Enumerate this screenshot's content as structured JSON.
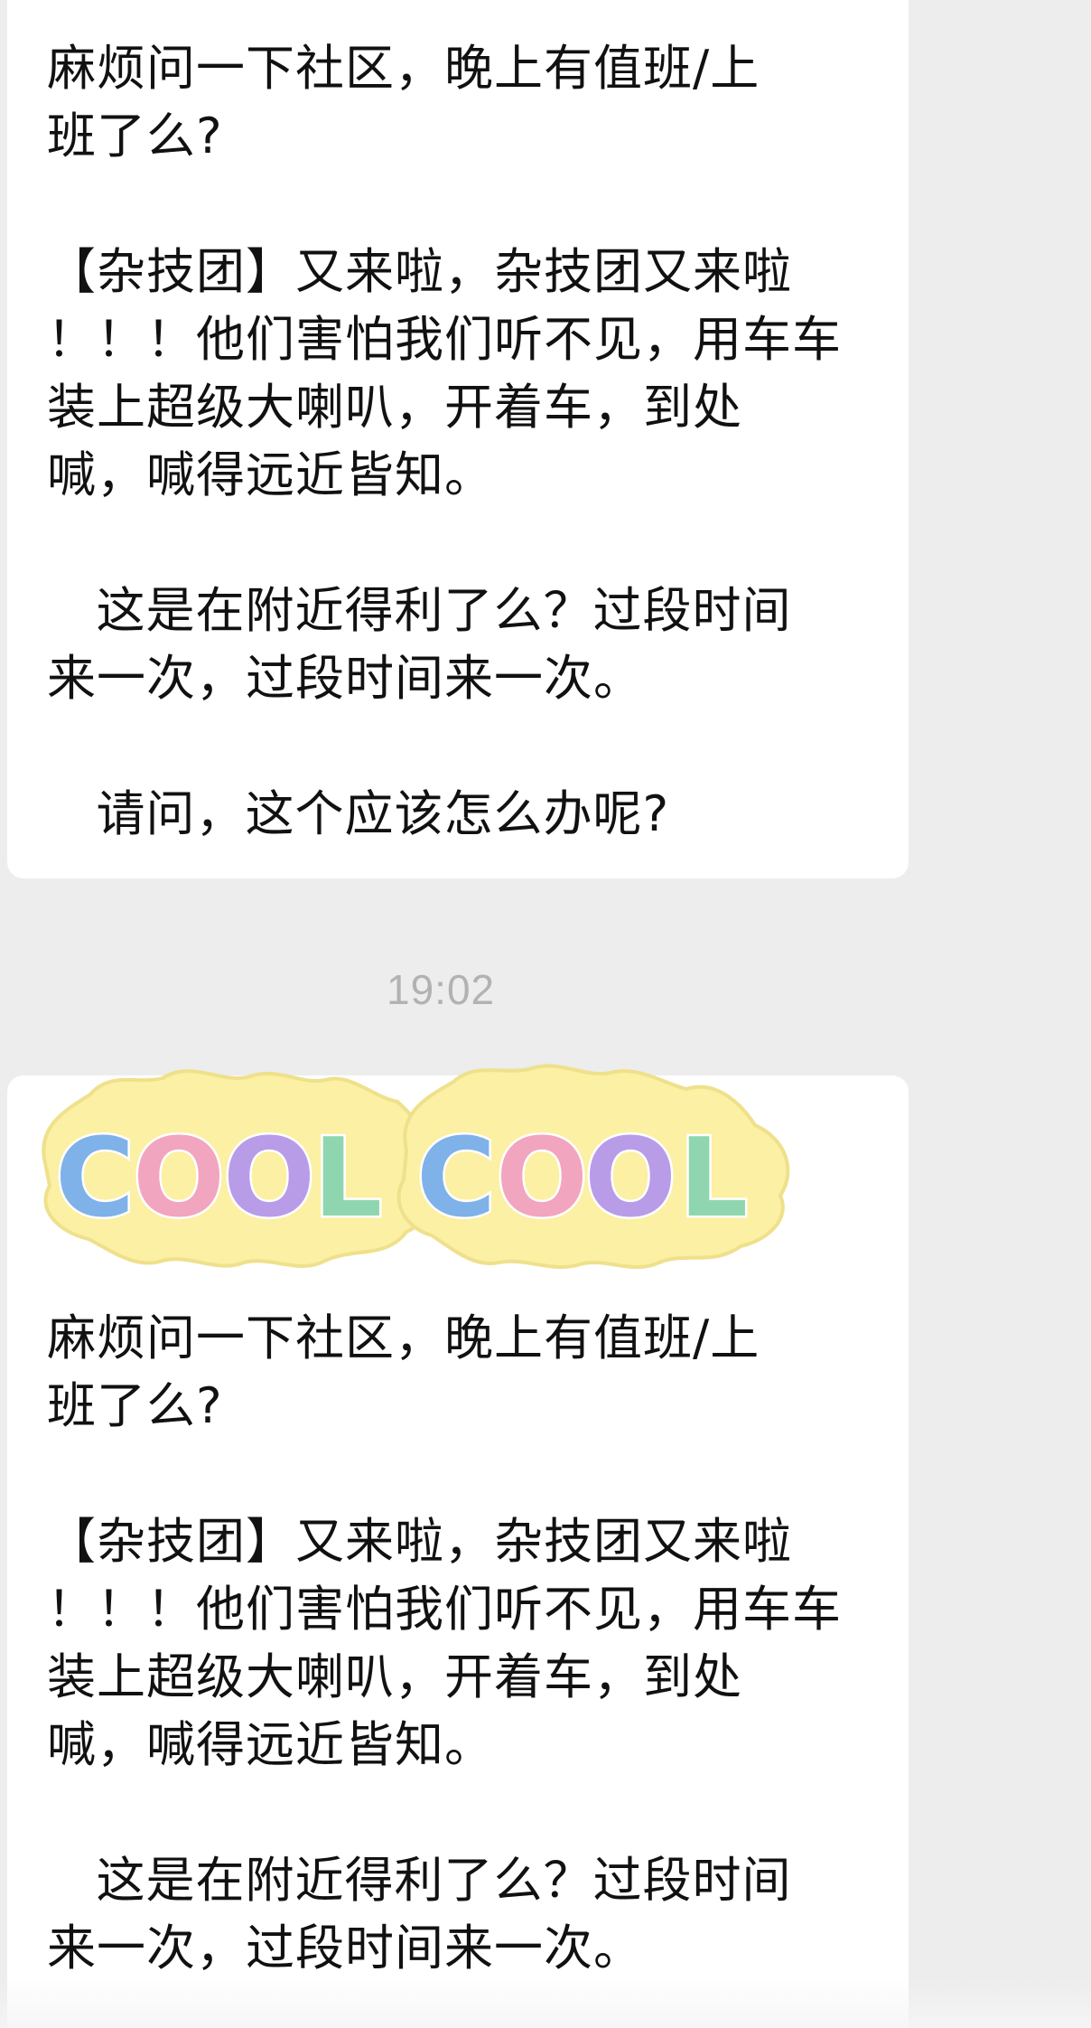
{
  "messages": [
    {
      "text": "麻烦问一下社区，晚上有值班/上\n班了么?\n\n【杂技团】又来啦，杂技团又来啦\n！！！他们害怕我们听不见，用车车\n装上超级大喇叭，开着车，到处\n喊，喊得远近皆知。\n\n   这是在附近得利了么？过段时间\n来一次，过段时间来一次。\n\n   请问，这个应该怎么办呢?"
    },
    {
      "text": "麻烦问一下社区，晚上有值班/上\n班了么?\n\n【杂技团】又来啦，杂技团又来啦\n！！！他们害怕我们听不见，用车车\n装上超级大喇叭，开着车，到处\n喊，喊得远近皆知。\n\n   这是在附近得利了么？过段时间\n来一次，过段时间来一次。"
    }
  ],
  "timestamp": "19:02",
  "sticker": {
    "text": "COOLCOOL",
    "letters": [
      "C",
      "O",
      "O",
      "L",
      "C",
      "O",
      "O",
      "L"
    ],
    "letter_colors": [
      "#7fb2e8",
      "#f2a5bf",
      "#b99ce8",
      "#8fd6b0",
      "#7fb2e8",
      "#f2a5bf",
      "#b99ce8",
      "#8fd6b0"
    ],
    "background_color": "#fbf0a3"
  },
  "colors": {
    "chat_background": "#ededed",
    "bubble_background": "#ffffff",
    "timestamp_text": "#b2b2b2"
  }
}
